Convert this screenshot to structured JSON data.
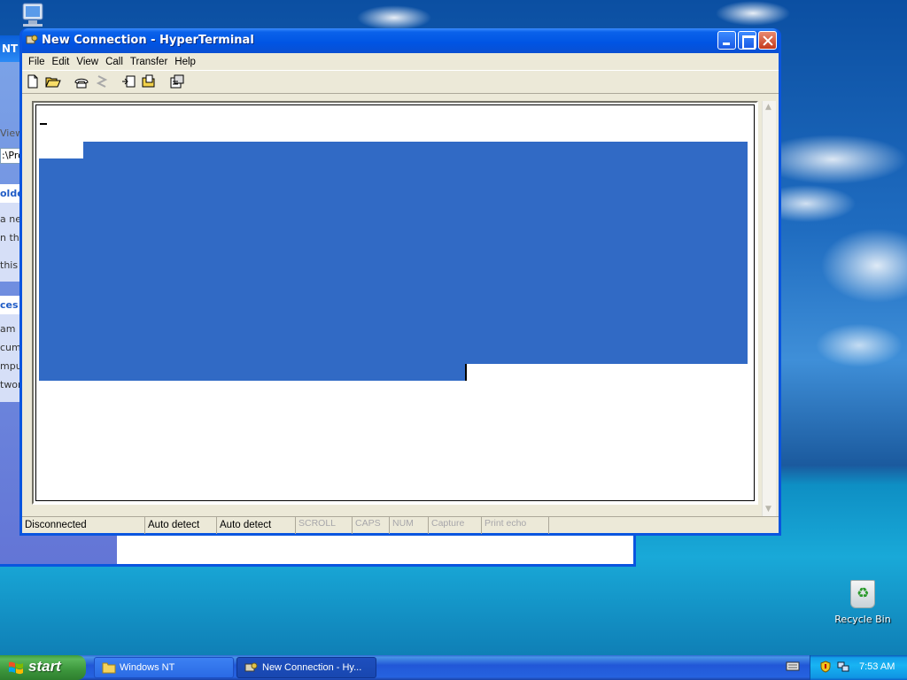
{
  "background_window": {
    "title_fragment": "NT",
    "view_fragment": "View",
    "address_fragment": ":\\Pro",
    "panel1": {
      "heading": "olde",
      "lines": [
        "a new",
        "n this",
        "this"
      ]
    },
    "panel2": {
      "heading": "ces",
      "lines": [
        "am Fi",
        "cume",
        "mpu",
        "twor"
      ]
    }
  },
  "window": {
    "title": "New Connection - HyperTerminal"
  },
  "menu": [
    "File",
    "Edit",
    "View",
    "Call",
    "Transfer",
    "Help"
  ],
  "toolbar": {
    "icons": [
      "new-icon",
      "open-icon",
      "call-icon",
      "disconnect-icon",
      "send-icon",
      "receive-icon",
      "properties-icon"
    ]
  },
  "status": {
    "connection": "Disconnected",
    "detect1": "Auto detect",
    "detect2": "Auto detect",
    "scroll": "SCROLL",
    "caps": "CAPS",
    "num": "NUM",
    "capture": "Capture",
    "print_echo": "Print echo"
  },
  "desktop": {
    "recycle_bin": "Recycle Bin"
  },
  "taskbar": {
    "start": "start",
    "tasks": [
      {
        "label": "Windows NT",
        "active": false
      },
      {
        "label": "New Connection - Hy...",
        "active": true
      }
    ],
    "clock": "7:53 AM"
  },
  "colors": {
    "selection": "#316ac5",
    "titlebar": "#0054e3",
    "window_face": "#ece9d8",
    "start_green": "#3c963c"
  }
}
